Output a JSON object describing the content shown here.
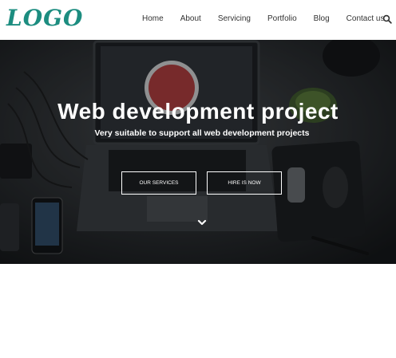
{
  "header": {
    "logo": "LOGO",
    "nav": [
      "Home",
      "About",
      "Servicing",
      "Portfolio",
      "Blog",
      "Contact us"
    ],
    "search_icon": "search-icon"
  },
  "hero": {
    "title": "Web development project",
    "subtitle": "Very suitable to support all web development projects",
    "buttons": {
      "services": "OUR SERVICES",
      "hire": "HIRE IS NOW"
    },
    "scroll_icon": "chevron-down-icon"
  },
  "colors": {
    "logo": "#1c8d80",
    "nav_text": "#333333",
    "hero_text": "#ffffff"
  }
}
